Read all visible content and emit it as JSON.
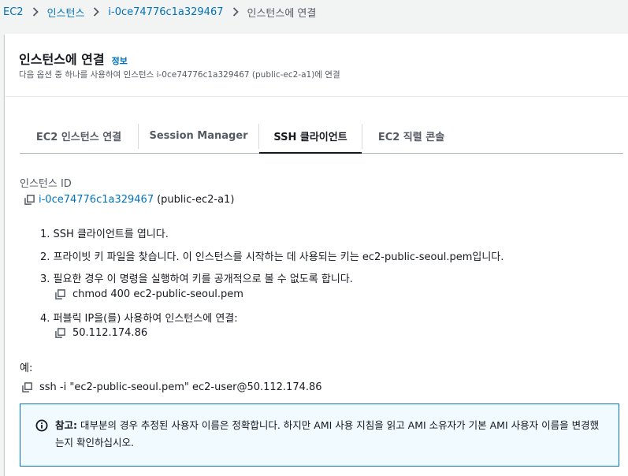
{
  "breadcrumb": {
    "items": [
      "EC2",
      "인스턴스",
      "i-0ce74776c1a329467"
    ],
    "current": "인스턴스에 연결"
  },
  "header": {
    "title": "인스턴스에 연결",
    "info_link": "정보",
    "description": "다음 옵션 중 하나를 사용하여 인스턴스 i-0ce74776c1a329467 (public-ec2-a1)에 연결"
  },
  "tabs": [
    {
      "label": "EC2 인스턴스 연결",
      "active": false
    },
    {
      "label": "Session Manager",
      "active": false
    },
    {
      "label": "SSH 클라이언트",
      "active": true
    },
    {
      "label": "EC2 직렬 콘솔",
      "active": false
    }
  ],
  "instance": {
    "label": "인스턴스 ID",
    "id": "i-0ce74776c1a329467",
    "name": "(public-ec2-a1)"
  },
  "steps": [
    "1. SSH 클라이언트를 엽니다.",
    "2. 프라이빗 키 파일을 찾습니다. 이 인스턴스를 시작하는 데 사용되는 키는 ec2-public-seoul.pem입니다.",
    "3. 필요한 경우 이 명령을 실행하여 키를 공개적으로 볼 수 없도록 합니다.",
    "4. 퍼블릭 IP을(를) 사용하여 인스턴스에 연결:"
  ],
  "commands": {
    "chmod": "chmod 400 ec2-public-seoul.pem",
    "public_ip": "50.112.174.86"
  },
  "example": {
    "label": "예:",
    "command": "ssh -i \"ec2-public-seoul.pem\" ec2-user@50.112.174.86"
  },
  "alert": {
    "title": "참고:",
    "body": " 대부분의 경우 추정된 사용자 이름은 정확합니다. 하지만 AMI 사용 지침을 읽고 AMI 소유자가 기본 AMI 사용자 이름을 변경했는지 확인하십시오."
  },
  "colors": {
    "link": "#0073bb",
    "alert_bg": "#f1faff",
    "alert_border": "#0073bb"
  },
  "icons": [
    "chevron-right-icon",
    "copy-icon",
    "info-circle-icon"
  ]
}
